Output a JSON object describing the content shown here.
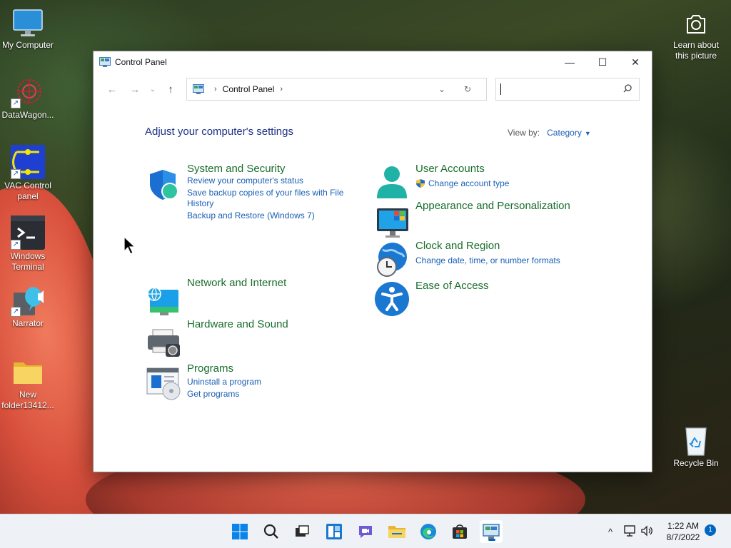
{
  "desktop": {
    "icons": [
      {
        "label": "My Computer"
      },
      {
        "label": "DataWagon..."
      },
      {
        "label": "VAC Control panel"
      },
      {
        "label": "Windows Terminal"
      },
      {
        "label": "Narrator"
      },
      {
        "label": "New folder13412..."
      },
      {
        "label": "Recycle Bin"
      }
    ],
    "learn_picture": "Learn about this picture"
  },
  "window": {
    "title": "Control Panel",
    "minimize": "—",
    "maximize": "☐",
    "close": "✕"
  },
  "nav": {
    "back": "←",
    "forward": "→",
    "recent": "⌄",
    "up": "↑",
    "breadcrumb": "Control Panel",
    "separator": "›",
    "dropdown": "⌄",
    "refresh": "↻",
    "search_value": "",
    "search_placeholder": ""
  },
  "content": {
    "heading": "Adjust your computer's settings",
    "view_by_label": "View by:",
    "view_by_value": "Category",
    "categories": [
      {
        "title": "System and Security",
        "links": [
          "Review your computer's status",
          "Save backup copies of your files with File",
          "History",
          "Backup and Restore (Windows 7)"
        ]
      },
      {
        "title": "Network and Internet",
        "links": []
      },
      {
        "title": "Hardware and Sound",
        "links": []
      },
      {
        "title": "Programs",
        "links": [
          "Uninstall a program",
          "Get programs"
        ]
      },
      {
        "title": "User Accounts",
        "links": [
          "Change account type"
        ]
      },
      {
        "title": "Appearance and Personalization",
        "links": []
      },
      {
        "title": "Clock and Region",
        "links": [
          "Change date, time, or number formats"
        ]
      },
      {
        "title": "Ease of Access",
        "links": []
      }
    ]
  },
  "taskbar": {
    "time": "1:22 AM",
    "date": "8/7/2022",
    "notifications": "1",
    "tray_chevron": "^"
  },
  "colors": {
    "heading": "#1e3287",
    "category_title": "#186e2c",
    "link": "#1a5fb4",
    "accent": "#0067c0"
  }
}
